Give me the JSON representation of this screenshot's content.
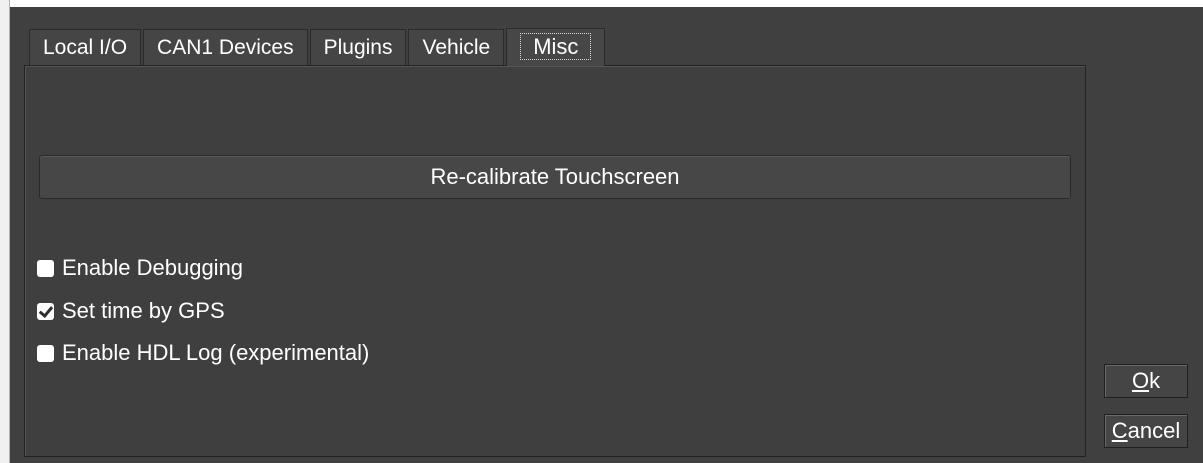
{
  "tabs": [
    {
      "label": "Local I/O",
      "active": false
    },
    {
      "label": "CAN1 Devices",
      "active": false
    },
    {
      "label": "Plugins",
      "active": false
    },
    {
      "label": "Vehicle",
      "active": false
    },
    {
      "label": "Misc",
      "active": true
    }
  ],
  "misc": {
    "recalibrate_label": "Re-calibrate Touchscreen",
    "options": [
      {
        "label": "Enable Debugging",
        "checked": false
      },
      {
        "label": "Set time by GPS",
        "checked": true
      },
      {
        "label": "Enable HDL Log (experimental)",
        "checked": false
      }
    ]
  },
  "buttons": {
    "ok": {
      "mnemonic": "O",
      "rest": "k"
    },
    "cancel": {
      "mnemonic": "C",
      "rest": "ancel"
    }
  },
  "colors": {
    "dialog_bg": "#404040",
    "text": "#ffffff"
  }
}
